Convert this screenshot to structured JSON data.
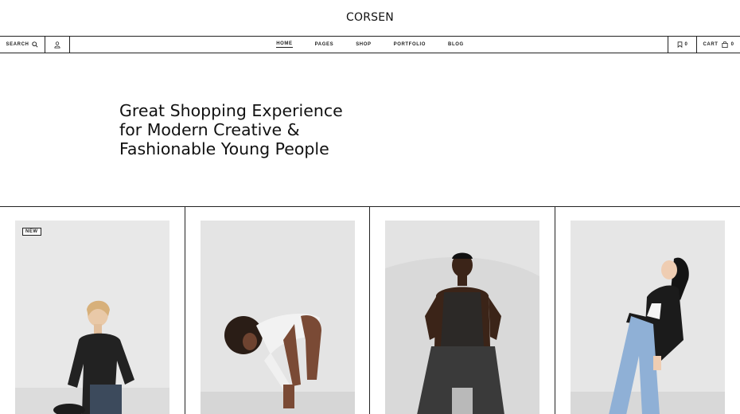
{
  "brand": {
    "logo": "CORSEN"
  },
  "nav": {
    "search_label": "SEARCH",
    "menu": [
      {
        "label": "HOME",
        "active": true
      },
      {
        "label": "PAGES",
        "active": false
      },
      {
        "label": "SHOP",
        "active": false
      },
      {
        "label": "PORTFOLIO",
        "active": false
      },
      {
        "label": "BLOG",
        "active": false
      }
    ],
    "wishlist_count": "0",
    "cart_label": "CART",
    "cart_count": "0"
  },
  "hero": {
    "line1": "Great Shopping Experience",
    "line2": "for Modern Creative &",
    "line3": "Fashionable Young People"
  },
  "products": [
    {
      "badge": "NEW",
      "image": "woman-black-top-photo"
    },
    {
      "image": "woman-bending-photo"
    },
    {
      "image": "man-mesh-top-photo"
    },
    {
      "image": "woman-leaning-back-photo"
    }
  ],
  "colors": {
    "text": "#111111",
    "border": "#222222",
    "photo_bg": "#e6e6e6"
  }
}
